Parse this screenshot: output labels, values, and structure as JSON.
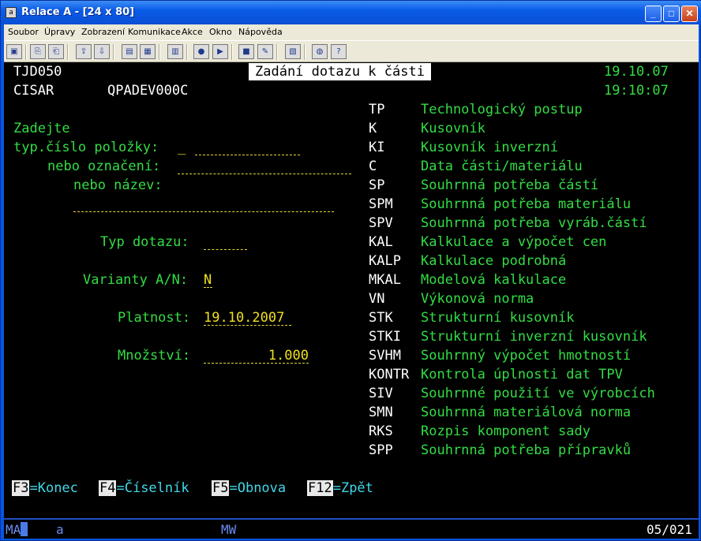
{
  "window": {
    "title": "Relace A - [24 x 80]",
    "icon_text": "a",
    "buttons": {
      "minimize": "_",
      "maximize": "□",
      "close": "✕"
    }
  },
  "menu": [
    "Soubor",
    "Úpravy",
    "Zobrazení",
    "Komunikace",
    "Akce",
    "Okno",
    "Nápověda"
  ],
  "toolbar": {
    "icons": [
      "screen-icon",
      "copy-icon",
      "paste-icon",
      "send-icon",
      "receive-icon",
      "display-icon",
      "display2-icon",
      "macro-icon",
      "record-icon",
      "play-icon",
      "stop-icon",
      "script-icon",
      "clipboard-icon",
      "globe-icon",
      "help-icon"
    ]
  },
  "screen": {
    "program": "TJD050",
    "user": "CISAR",
    "device": "QPADEV000C",
    "title": "Zadání dotazu k části",
    "date": "19.10.07",
    "time": "19:10:07",
    "prompt": "Zadejte",
    "labels": {
      "typ_cislo": "typ.číslo položky:",
      "oznaceni": "nebo označení:",
      "nazev": "nebo název:",
      "typ_dotazu": "Typ dotazu:",
      "varianty": "Varianty A/N:",
      "platnost": "Platnost:",
      "mnozstvi": "Množství:"
    },
    "values": {
      "typ_cislo_prefix": "_",
      "varianty": "N",
      "platnost": "19.10.2007",
      "mnozstvi": "1.000"
    },
    "options": [
      {
        "code": "TP",
        "desc": "Technologický postup"
      },
      {
        "code": "K",
        "desc": "Kusovník"
      },
      {
        "code": "KI",
        "desc": "Kusovník inverzní"
      },
      {
        "code": "C",
        "desc": "Data části/materiálu"
      },
      {
        "code": "SP",
        "desc": "Souhrnná potřeba částí"
      },
      {
        "code": "SPM",
        "desc": "Souhrnná potřeba materiálu"
      },
      {
        "code": "SPV",
        "desc": "Souhrnná potřeba vyráb.částí"
      },
      {
        "code": "KAL",
        "desc": "Kalkulace a výpočet cen"
      },
      {
        "code": "KALP",
        "desc": "Kalkulace podrobná"
      },
      {
        "code": "MKAL",
        "desc": "Modelová kalkulace"
      },
      {
        "code": "VN",
        "desc": "Výkonová norma"
      },
      {
        "code": "STK",
        "desc": "Strukturní kusovník"
      },
      {
        "code": "STKI",
        "desc": "Strukturní inverzní kusovník"
      },
      {
        "code": "SVHM",
        "desc": "Souhrnný výpočet hmotností"
      },
      {
        "code": "KONTR",
        "desc": "Kontrola úplnosti dat TPV"
      },
      {
        "code": "SIV",
        "desc": "Souhrnné použití ve výrobcích"
      },
      {
        "code": "SMN",
        "desc": "Souhrnná materiálová norma"
      },
      {
        "code": "RKS",
        "desc": "Rozpis komponent sady"
      },
      {
        "code": "SPP",
        "desc": "Souhrnná potřeba přípravků"
      }
    ],
    "fkeys": [
      {
        "key": "F3",
        "label": "=Konec"
      },
      {
        "key": "F4",
        "label": "=Číselník"
      },
      {
        "key": "F5",
        "label": "=Obnova"
      },
      {
        "key": "F12",
        "label": "=Zpět"
      }
    ]
  },
  "status": {
    "session": "MA",
    "mode": "a",
    "indicator": "MW",
    "position": "05/021"
  }
}
